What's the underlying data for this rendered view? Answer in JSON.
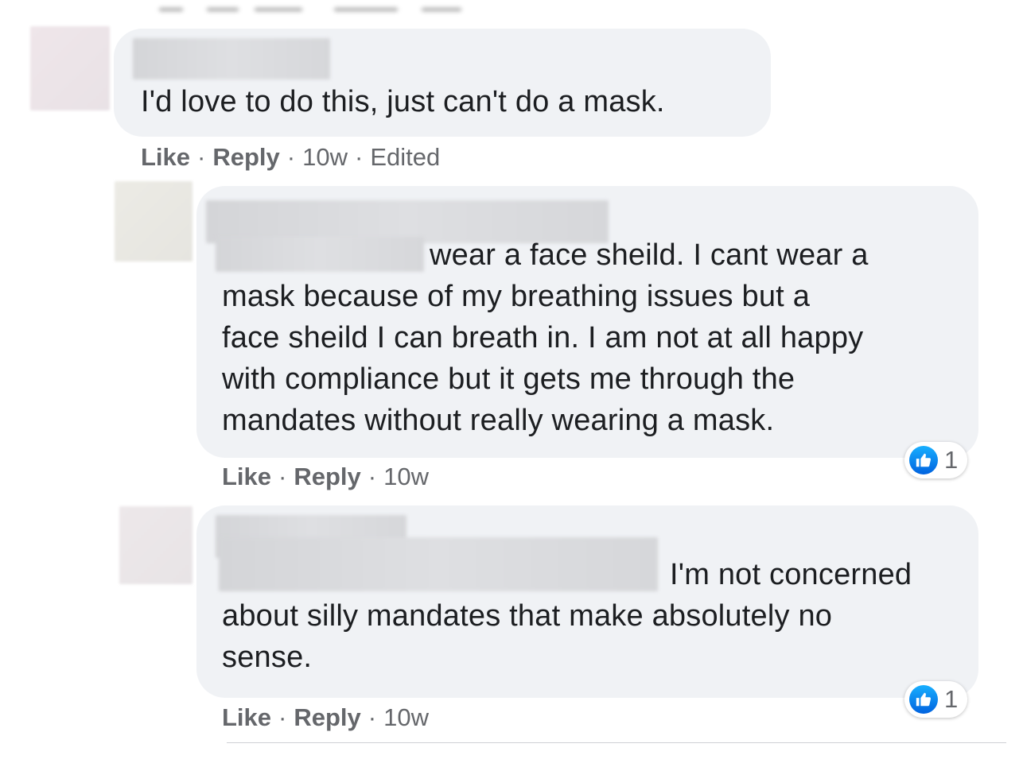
{
  "comments": [
    {
      "text_lines": [
        "I'd love to do this, just can't do a mask."
      ],
      "actions": {
        "like": "Like",
        "reply": "Reply",
        "time": "10w",
        "edited": "Edited"
      }
    },
    {
      "text_lines": [
        "wear a face sheild. I cant wear a",
        "mask because of my breathing issues but a",
        "face sheild I can breath in. I am not at all happy",
        "with compliance but it gets me through the",
        "mandates without really wearing a mask."
      ],
      "actions": {
        "like": "Like",
        "reply": "Reply",
        "time": "10w"
      },
      "reaction_count": "1"
    },
    {
      "text_lines": [
        "I'm not concerned",
        "about silly mandates that make absolutely no",
        "sense."
      ],
      "actions": {
        "like": "Like",
        "reply": "Reply",
        "time": "10w"
      },
      "reaction_count": "1"
    }
  ],
  "separator": "·",
  "icons": {
    "reaction": "like-thumbs-up-icon"
  },
  "colors": {
    "bubble": "#f0f2f5",
    "meta_text": "#65676b",
    "like_blue": "#0571ed"
  }
}
